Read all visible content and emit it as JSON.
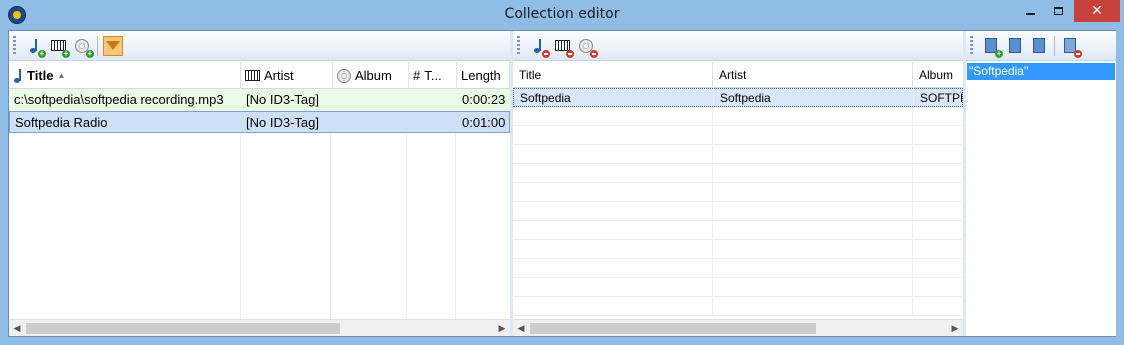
{
  "window": {
    "title": "Collection editor",
    "close_glyph": "✕"
  },
  "colors": {
    "title_bar": "#8fbde6",
    "close_button": "#c7413c",
    "row_green": "#e9fbe5",
    "row_selected": "#cde0f7",
    "list_selected": "#3399ff",
    "filter_active": "#f9c57a"
  },
  "left_pane": {
    "toolbar": [
      {
        "name": "add-track-button",
        "icon": "note-plus-icon"
      },
      {
        "name": "add-artist-button",
        "icon": "piano-plus-icon"
      },
      {
        "name": "add-album-button",
        "icon": "disc-plus-icon"
      },
      {
        "name": "filter-button",
        "icon": "funnel-icon",
        "active": true
      }
    ],
    "columns": [
      {
        "label": "Title",
        "icon": "note-icon",
        "sorted": "ascending",
        "sort_glyph": "▲"
      },
      {
        "label": "Artist",
        "icon": "piano-icon"
      },
      {
        "label": "Album",
        "icon": "disc-icon"
      },
      {
        "label": "T...",
        "icon_glyph": "#"
      },
      {
        "label": "Length"
      }
    ],
    "rows": [
      {
        "title": "c:\\softpedia\\softpedia recording.mp3",
        "artist": "[No ID3-Tag]",
        "album": "",
        "track": "",
        "length": "0:00:23"
      },
      {
        "title": "Softpedia Radio",
        "artist": "[No ID3-Tag]",
        "album": "",
        "track": "",
        "length": "0:01:00"
      }
    ],
    "scroll": {
      "left_arrow": "◀",
      "right_arrow": "▶"
    }
  },
  "middle_pane": {
    "toolbar": [
      {
        "name": "remove-track-button",
        "icon": "note-minus-icon"
      },
      {
        "name": "remove-artist-button",
        "icon": "piano-minus-icon"
      },
      {
        "name": "remove-album-button",
        "icon": "disc-minus-icon"
      }
    ],
    "columns": [
      "Title",
      "Artist",
      "Album"
    ],
    "rows": [
      {
        "title": "Softpedia",
        "artist": "Softpedia",
        "album": "SOFTPE"
      }
    ],
    "scroll": {
      "left_arrow": "◀",
      "right_arrow": "▶"
    }
  },
  "right_pane": {
    "toolbar": [
      {
        "name": "new-collection-button",
        "icon": "doc-plus-icon"
      },
      {
        "name": "edit-collection-button",
        "icon": "doc-edit-icon"
      },
      {
        "name": "import-collection-button",
        "icon": "doc-arrow-icon"
      },
      {
        "name": "delete-collection-button",
        "icon": "doc-minus-icon"
      }
    ],
    "items": [
      "\"Softpedia\""
    ]
  }
}
